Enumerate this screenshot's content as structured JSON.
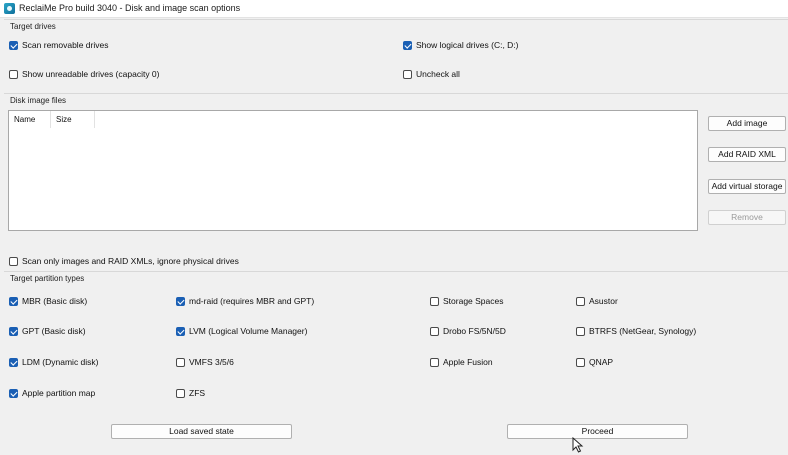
{
  "window": {
    "title": "ReclaiMe Pro build 3040 - Disk and image scan options"
  },
  "target_drives": {
    "label": "Target drives",
    "scan_removable": {
      "label": "Scan removable drives",
      "checked": true
    },
    "show_logical": {
      "label": "Show logical drives (C:, D:)",
      "checked": true
    },
    "show_unreadable": {
      "label": "Show unreadable drives (capacity 0)",
      "checked": false
    },
    "uncheck_all": {
      "label": "Uncheck all",
      "checked": false
    }
  },
  "disk_images": {
    "label": "Disk image files",
    "columns": [
      "Name",
      "Size"
    ],
    "buttons": {
      "add_image": "Add image",
      "add_raid_xml": "Add RAID XML",
      "add_virtual_storage": "Add virtual storage",
      "remove": "Remove"
    },
    "scan_only_images": {
      "label": "Scan only images and RAID XMLs, ignore physical drives",
      "checked": false
    }
  },
  "partition_types": {
    "label": "Target partition types",
    "items": [
      {
        "label": "MBR (Basic disk)",
        "checked": true
      },
      {
        "label": "GPT (Basic disk)",
        "checked": true
      },
      {
        "label": "LDM (Dynamic disk)",
        "checked": true
      },
      {
        "label": "Apple partition map",
        "checked": true
      },
      {
        "label": "md-raid (requires MBR and GPT)",
        "checked": true
      },
      {
        "label": "LVM (Logical Volume Manager)",
        "checked": true
      },
      {
        "label": "VMFS 3/5/6",
        "checked": false
      },
      {
        "label": "ZFS",
        "checked": false
      },
      {
        "label": "Storage Spaces",
        "checked": false
      },
      {
        "label": "Drobo FS/5N/5D",
        "checked": false
      },
      {
        "label": "Apple Fusion",
        "checked": false
      },
      {
        "label": "Asustor",
        "checked": false
      },
      {
        "label": "BTRFS (NetGear, Synology)",
        "checked": false
      },
      {
        "label": "QNAP",
        "checked": false
      }
    ]
  },
  "footer": {
    "load_saved_state": "Load saved state",
    "proceed": "Proceed"
  }
}
